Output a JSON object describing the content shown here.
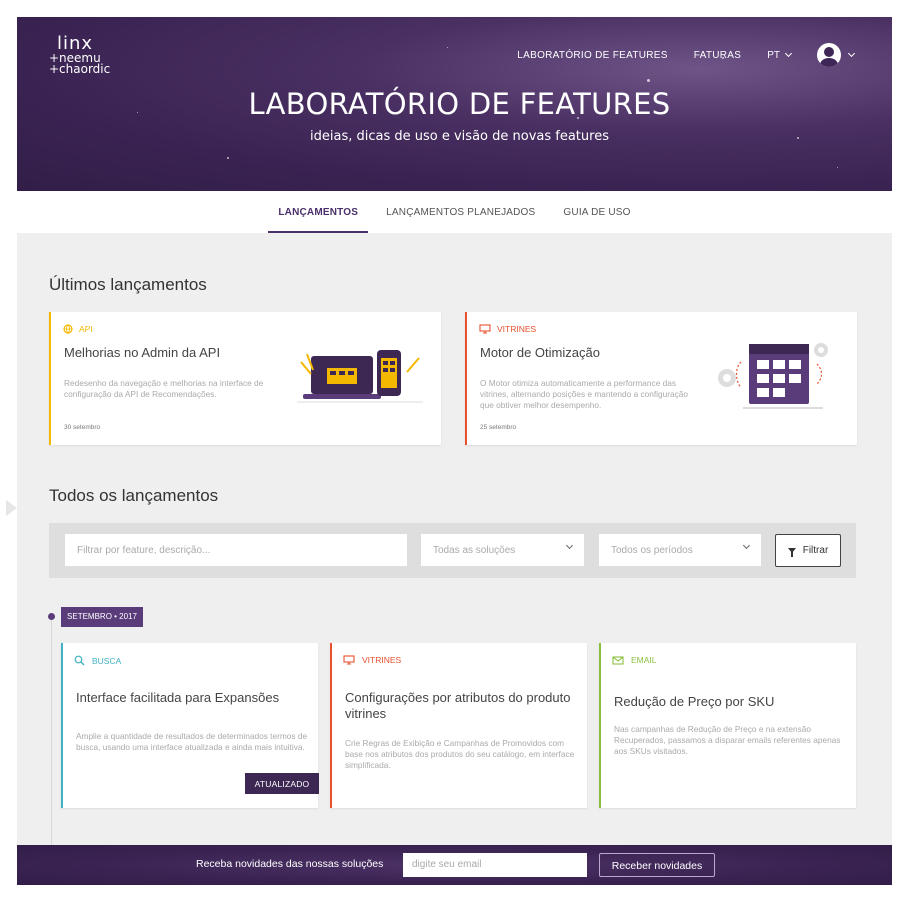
{
  "logo": {
    "line1": "linx",
    "line2": "+neemu",
    "line3": "+chaordic"
  },
  "nav": {
    "lab_label": "LABORATÓRIO DE FEATURES",
    "invoices_label": "FATURAS",
    "lang_label": "PT"
  },
  "hero": {
    "title": "LABORATÓRIO DE FEATURES",
    "subtitle": "ideias, dicas de uso e visão de novas features"
  },
  "tabs": [
    {
      "label": "LANÇAMENTOS",
      "active": true
    },
    {
      "label": "LANÇAMENTOS PLANEJADOS",
      "active": false
    },
    {
      "label": "GUIA DE USO",
      "active": false
    }
  ],
  "latest": {
    "title": "Últimos lançamentos",
    "cards": [
      {
        "tag": "API",
        "tag_color": "#f5b800",
        "title": "Melhorias no Admin da API",
        "description": "Redesenho da navegação e melhorias na interface de configuração da API de Recomendações.",
        "date": "30 setembro"
      },
      {
        "tag": "VITRINES",
        "tag_color": "#e8502e",
        "title": "Motor de Otimização",
        "description": "O Motor otimiza automaticamente a performance das vitrines, alternando posições e mantendo a configuração que obtiver melhor desempenho.",
        "date": "25 setembro"
      }
    ]
  },
  "all": {
    "title": "Todos os lançamentos",
    "filter": {
      "search_placeholder": "Filtrar por feature, descrição...",
      "solutions_value": "Todas as soluções",
      "periods_value": "Todos os períodos",
      "button_label": "Filtrar"
    },
    "month_badge": "SETEMBRO • 2017",
    "cards": [
      {
        "tag": "BUSCA",
        "tag_color": "#3fb3c2",
        "title": "Interface facilitada para Expansões",
        "description": "Amplie a quantidade de resultados de determinados termos de busca, usando uma interface atualizada e ainda mais intuitiva.",
        "badge": "ATUALIZADO"
      },
      {
        "tag": "VITRINES",
        "tag_color": "#e8502e",
        "title": "Configurações por atributos do produto vitrines",
        "description": "Crie Regras de Exibição e Campanhas de Promovidos com base nos atributos dos produtos do seu catálogo, em interface simplificada."
      },
      {
        "tag": "EMAIL",
        "tag_color": "#8bbf3f",
        "title": "Redução de Preço por SKU",
        "description": "Nas campanhas de Redução de Preço e na extensão Recuperados, passamos a disparar emails referentes apenas aos SKUs visitados."
      }
    ]
  },
  "footer": {
    "text": "Receba novidades das nossas soluções",
    "email_placeholder": "digite seu email",
    "button_label": "Receber novidades"
  }
}
